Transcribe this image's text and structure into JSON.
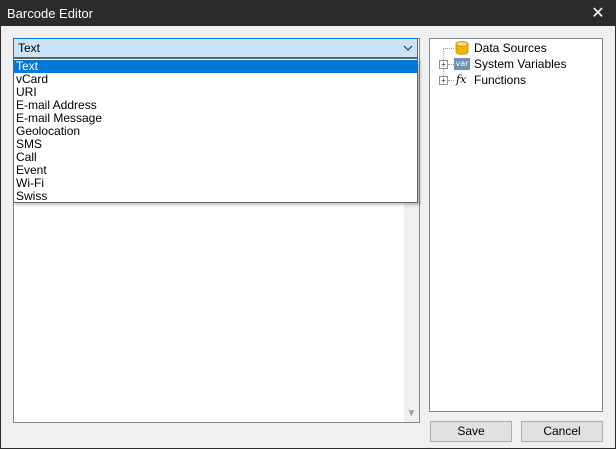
{
  "window": {
    "title": "Barcode Editor",
    "close_glyph": "✕"
  },
  "editor": {
    "type_combo": {
      "value": "Text",
      "options": [
        "Text",
        "vCard",
        "URI",
        "E-mail Address",
        "E-mail Message",
        "Geolocation",
        "SMS",
        "Call",
        "Event",
        "Wi-Fi",
        "Swiss"
      ],
      "selected_index": 0
    }
  },
  "tree": {
    "items": [
      {
        "label": "Data Sources",
        "icon": "database-icon",
        "expandable": false
      },
      {
        "label": "System Variables",
        "icon": "var-icon",
        "icon_text": "var",
        "expandable": true
      },
      {
        "label": "Functions",
        "icon": "function-icon",
        "icon_text": "fx",
        "expandable": true
      }
    ],
    "expander_glyph": "+"
  },
  "buttons": {
    "save_label": "Save",
    "cancel_label": "Cancel"
  },
  "colors": {
    "titlebar": "#2b2b2b",
    "selection": "#0078d7",
    "combo_focus": "#cce4f7",
    "database_icon": "#f2b600"
  }
}
